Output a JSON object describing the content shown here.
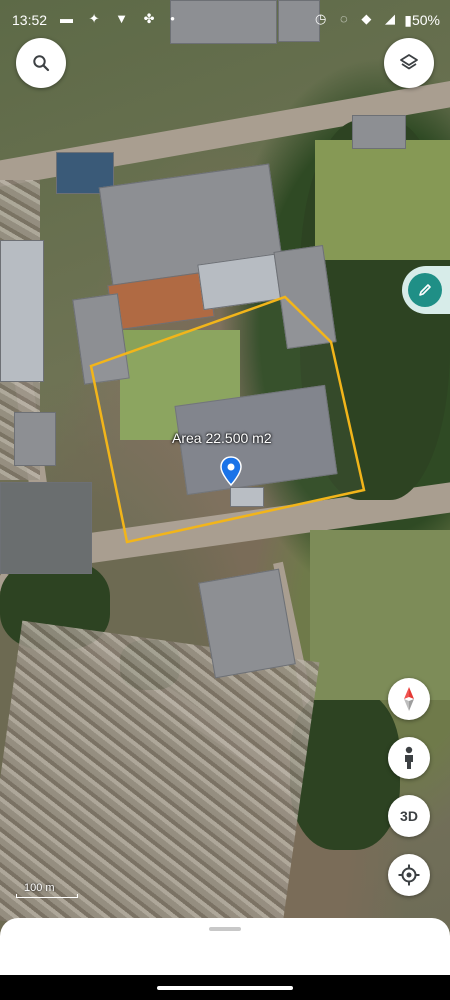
{
  "status_bar": {
    "time": "13:52",
    "left_icons": [
      "message-icon",
      "tinder-icon",
      "vpn-icon",
      "fan-icon",
      "dot-icon"
    ],
    "right_icons": [
      "alarm-icon",
      "mute-icon",
      "wifi-icon",
      "signal-icon"
    ],
    "battery": "50%"
  },
  "map": {
    "area_label": "Area 22.500 m2",
    "scale_label": "100 m",
    "boundary_color": "#f2b51a",
    "pin_color": "#1a73e8"
  },
  "controls": {
    "search_icon": "search-icon",
    "layers_icon": "layers-icon",
    "measure_icon": "pen-icon",
    "compass_icon": "compass-icon",
    "street_view_icon": "pegman-icon",
    "three_d_label": "3D",
    "location_icon": "my-location-icon"
  }
}
